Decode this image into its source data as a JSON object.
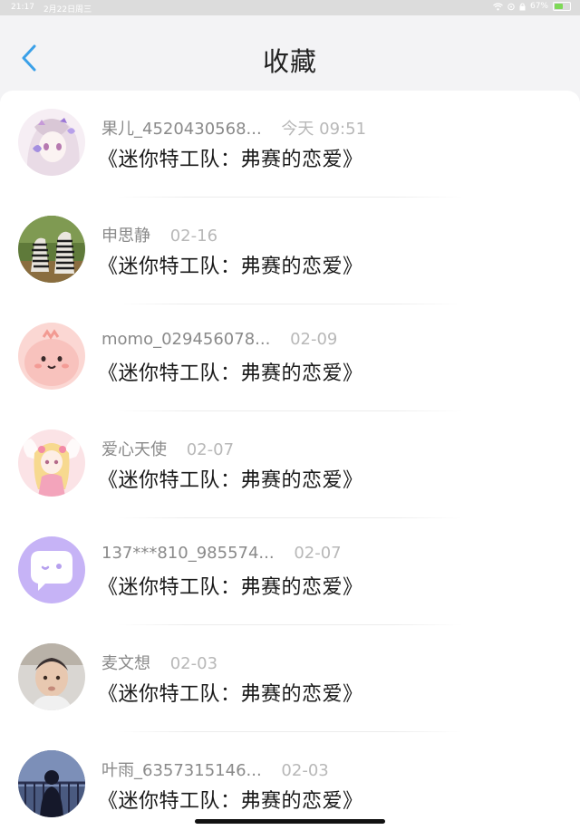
{
  "status_bar": {
    "time": "21:17",
    "date": "2月22日周三",
    "battery_percent": "67%",
    "battery_level": 0.67,
    "wifi_icon": "wifi-icon",
    "battery_icon": "battery-icon"
  },
  "header": {
    "title": "收藏",
    "back_icon": "chevron-left-icon",
    "accent_color": "#3aa0e8"
  },
  "favorites": [
    {
      "name": "果儿_4520430568...",
      "date": "今天 09:51",
      "title": "《迷你特工队：弗赛的恋爱》",
      "avatar": "anime-girl-avatar"
    },
    {
      "name": "申思静",
      "date": "02-16",
      "title": "《迷你特工队：弗赛的恋爱》",
      "avatar": "zebras-avatar"
    },
    {
      "name": "momo_029456078...",
      "date": "02-09",
      "title": "《迷你特工队：弗赛的恋爱》",
      "avatar": "pink-blob-avatar"
    },
    {
      "name": "爱心天使",
      "date": "02-07",
      "title": "《迷你特工队：弗赛的恋爱》",
      "avatar": "angel-girl-avatar"
    },
    {
      "name": "137***810_985574...",
      "date": "02-07",
      "title": "《迷你特工队：弗赛的恋爱》",
      "avatar": "chat-bubble-avatar"
    },
    {
      "name": "麦文想",
      "date": "02-03",
      "title": "《迷你特工队：弗赛的恋爱》",
      "avatar": "baby-photo-avatar"
    },
    {
      "name": "叶雨_6357315146...",
      "date": "02-03",
      "title": "《迷你特工队：弗赛的恋爱》",
      "avatar": "night-window-avatar"
    }
  ]
}
